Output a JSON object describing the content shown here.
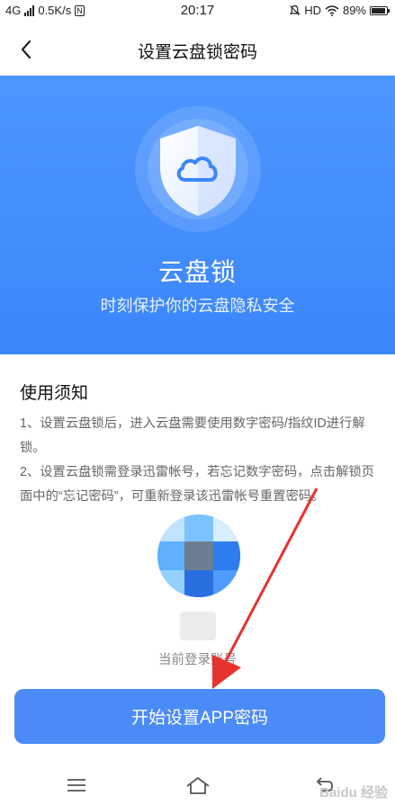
{
  "status_bar": {
    "network": "4G",
    "speed": "0.5K/s",
    "time": "20:17",
    "hd": "HD",
    "battery": "89%"
  },
  "nav": {
    "title": "设置云盘锁密码"
  },
  "hero": {
    "title": "云盘锁",
    "subtitle": "时刻保护你的云盘隐私安全"
  },
  "notice": {
    "title": "使用须知",
    "item1": "1、设置云盘锁后，进入云盘需要使用数字密码/指纹ID进行解锁。",
    "item2": "2、设置云盘锁需登录迅雷帐号，若忘记数字密码，点击解锁页面中的“忘记密码”，可重新登录该迅雷帐号重置密码。"
  },
  "account": {
    "label": "当前登录账号"
  },
  "cta": {
    "label": "开始设置APP密码"
  },
  "colors": {
    "primary": "#4b8bf7",
    "hero_top": "#4d96ff",
    "annotation_arrow": "#e8322e"
  },
  "icons": {
    "back": "chevron-left-icon",
    "shield": "shield-cloud-icon",
    "menu": "menu-icon",
    "home": "home-icon",
    "back_nav": "return-icon"
  },
  "watermark": "Baidu 经验"
}
